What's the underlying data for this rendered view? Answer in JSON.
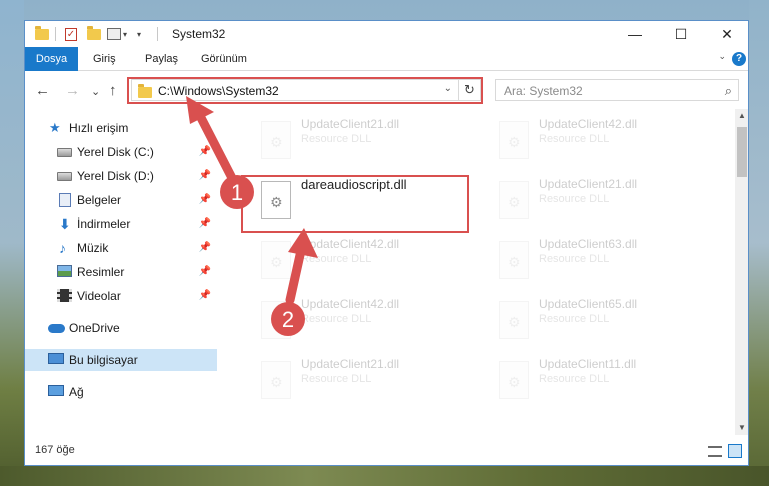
{
  "window": {
    "title": "System32",
    "minimize_glyph": "—",
    "maximize_glyph": "☐",
    "close_glyph": "✕"
  },
  "ribbon": {
    "tabs": [
      "Dosya",
      "Giriş",
      "Paylaş",
      "Görünüm"
    ],
    "expand_glyph": "⌄",
    "help_glyph": "?"
  },
  "nav": {
    "back": "←",
    "forward": "→",
    "recent": "⌄",
    "up": "↑",
    "address": "C:\\Windows\\System32",
    "dropdown": "⌄",
    "refresh": "↻",
    "search_placeholder": "Ara: System32",
    "search_icon": "⌕"
  },
  "sidebar": {
    "items": [
      {
        "label": "Hızlı erişim",
        "icon": "star-icon",
        "pinned": false
      },
      {
        "label": "Yerel Disk (C:)",
        "icon": "drive-icon",
        "pinned": true
      },
      {
        "label": "Yerel Disk (D:)",
        "icon": "drive-icon",
        "pinned": true
      },
      {
        "label": "Belgeler",
        "icon": "documents-icon",
        "pinned": true
      },
      {
        "label": "İndirmeler",
        "icon": "downloads-icon",
        "pinned": true
      },
      {
        "label": "Müzik",
        "icon": "music-icon",
        "pinned": true
      },
      {
        "label": "Resimler",
        "icon": "pictures-icon",
        "pinned": true
      },
      {
        "label": "Videolar",
        "icon": "videos-icon",
        "pinned": true
      },
      {
        "label": "OneDrive",
        "icon": "onedrive-icon",
        "pinned": false
      },
      {
        "label": "Bu bilgisayar",
        "icon": "this-pc-icon",
        "pinned": false
      },
      {
        "label": "Ağ",
        "icon": "network-icon",
        "pinned": false
      }
    ],
    "pin_glyph": "📌"
  },
  "files": [
    {
      "name": "UpdateClient21.dll",
      "desc": "Resource DLL"
    },
    {
      "name": "UpdateClient42.dll",
      "desc": "Resource DLL"
    },
    {
      "name": "dareaudioscript.dll",
      "desc": ""
    },
    {
      "name": "UpdateClient21.dll",
      "desc": "Resource DLL"
    },
    {
      "name": "UpdateClient42.dll",
      "desc": "Resource DLL"
    },
    {
      "name": "UpdateClient63.dll",
      "desc": "Resource DLL"
    },
    {
      "name": "UpdateClient42.dll",
      "desc": "Resource DLL"
    },
    {
      "name": "UpdateClient65.dll",
      "desc": "Resource DLL"
    },
    {
      "name": "UpdateClient21.dll",
      "desc": "Resource DLL"
    },
    {
      "name": "UpdateClient11.dll",
      "desc": "Resource DLL"
    }
  ],
  "scrollbar": {
    "up": "▲",
    "down": "▼"
  },
  "status": {
    "count": "167 öğe"
  },
  "annotations": {
    "step1": "1",
    "step2": "2",
    "color": "#d9504f"
  }
}
